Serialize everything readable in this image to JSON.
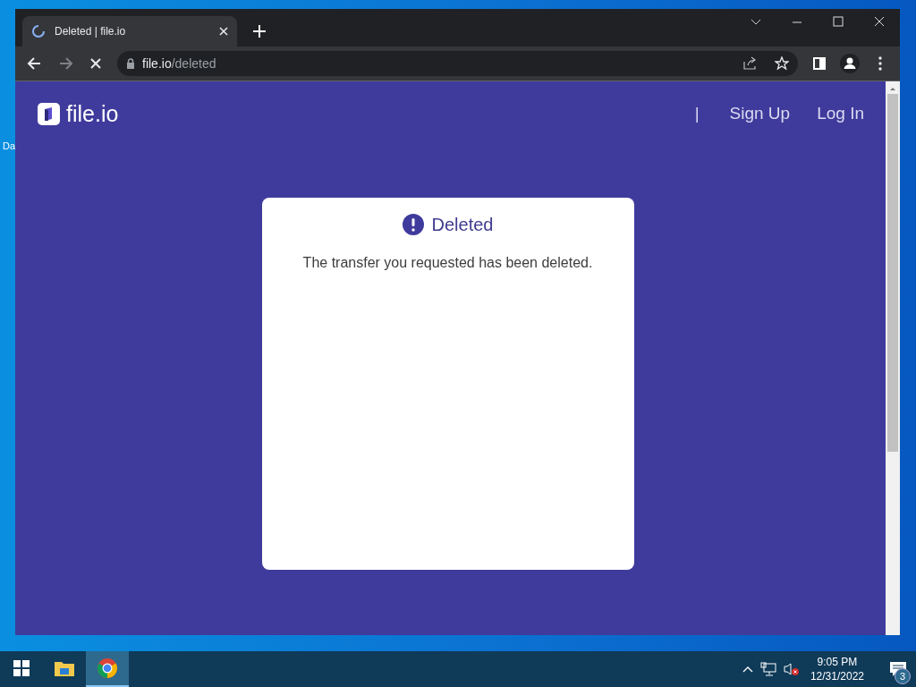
{
  "desktop": {
    "icon_label": "Da"
  },
  "browser": {
    "tabs": [
      {
        "title": "Deleted | file.io",
        "selected": true
      }
    ],
    "address": {
      "host": "file.io",
      "path": "/deleted"
    }
  },
  "site": {
    "logo": "file.io",
    "nav": [
      {
        "label": "|",
        "kind": "separator"
      },
      {
        "label": "Sign Up",
        "kind": "link"
      },
      {
        "label": "Log In",
        "kind": "link"
      }
    ],
    "card": {
      "title": "Deleted",
      "message": "The transfer you requested has been deleted."
    }
  },
  "taskbar": {
    "apps": [
      {
        "kind": "explorer",
        "selected": false
      },
      {
        "kind": "chrome",
        "selected": true
      }
    ],
    "time": "9:05 PM",
    "date": "12/31/2022",
    "notifications": "3"
  }
}
